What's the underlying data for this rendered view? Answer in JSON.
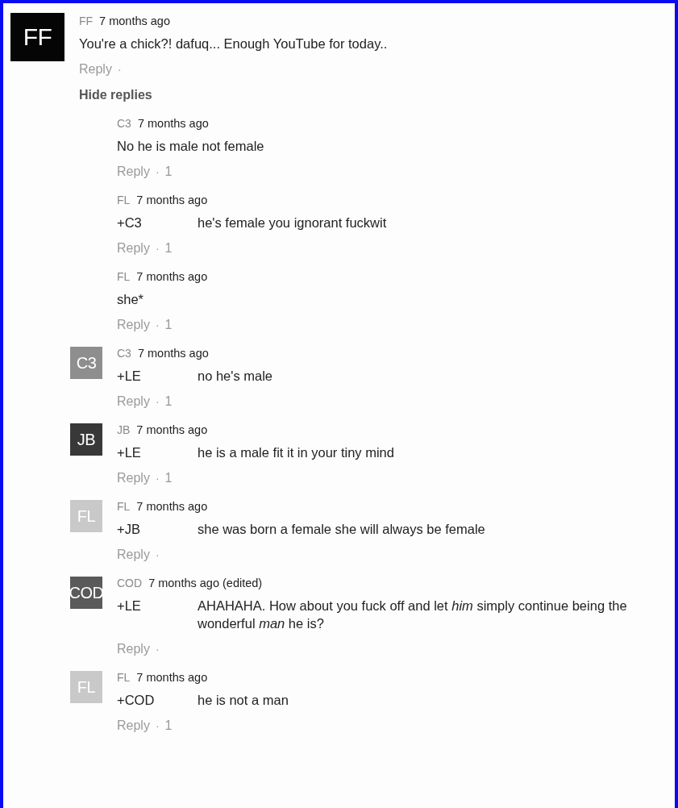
{
  "comment": {
    "avatar": {
      "initials": "FF",
      "color": "#050505"
    },
    "author": "FF",
    "time": "7 months ago",
    "text": "You're a chick?! dafuq... Enough YouTube for today..",
    "reply_label": "Reply",
    "dot": "·",
    "toggle": "Hide replies",
    "replies": [
      {
        "author": "C3",
        "time": "7 months ago",
        "text": "No he is male not female",
        "reply_label": "Reply",
        "dot": "·",
        "likes": "1"
      },
      {
        "author": "FL",
        "time": "7 months ago",
        "mention": "+C3",
        "text": "he's female you ignorant fuckwit",
        "reply_label": "Reply",
        "dot": "·",
        "likes": "1"
      },
      {
        "author": "FL",
        "time": "7 months ago",
        "text": "she*",
        "reply_label": "Reply",
        "dot": "·",
        "likes": "1"
      },
      {
        "avatar": {
          "initials": "C3",
          "color": "#8e8e8e"
        },
        "author": "C3",
        "time": "7 months ago",
        "mention": "+LE",
        "text": "no he's male",
        "reply_label": "Reply",
        "dot": "·",
        "likes": "1"
      },
      {
        "avatar": {
          "initials": "JB",
          "color": "#383838"
        },
        "author": "JB",
        "time": "7 months ago",
        "mention": "+LE",
        "text": "he is a male fit it in your tiny mind",
        "reply_label": "Reply",
        "dot": "·",
        "likes": "1"
      },
      {
        "avatar": {
          "initials": "FL",
          "color": "#c9c9c9"
        },
        "author": "FL",
        "time": "7 months ago",
        "mention": "+JB",
        "text": "she was born a female she will always be female",
        "reply_label": "Reply",
        "dot": "·"
      },
      {
        "avatar": {
          "initials": "COD",
          "color": "#5a5a5a"
        },
        "author": "COD",
        "time": "7 months ago (edited)",
        "mention": "+LE",
        "text": "AHAHAHA. How about you fuck off and let *him* simply continue being the wonderful *man* he is?",
        "reply_label": "Reply",
        "dot": "·"
      },
      {
        "avatar": {
          "initials": "FL",
          "color": "#c9c9c9"
        },
        "author": "FL",
        "time": "7 months ago",
        "mention": "+COD",
        "text": "he is not a man",
        "reply_label": "Reply",
        "dot": "·",
        "likes": "1"
      }
    ]
  }
}
